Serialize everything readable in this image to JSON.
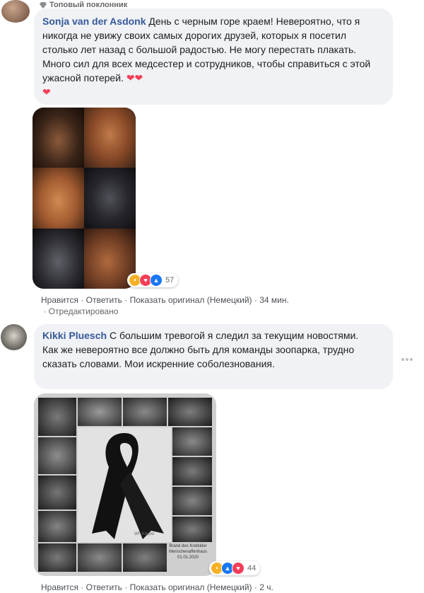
{
  "comment1": {
    "badge": "Топовый поклонник",
    "name": "Sonja van der Asdonk",
    "text": "День с черным горе краем! Невероятно, что я никогда не увижу своих самых дорогих друзей, которых я посетил столько лет назад с большой радостью. Не могу перестать плакать. Много сил для всех медсестер и сотрудников, чтобы справиться с этой ужасной потерей.",
    "reaction_count": "57",
    "actions": {
      "like": "Нравится",
      "reply": "Ответить",
      "show_original": "Показать оригинал (Немецкий)",
      "time": "34 мин.",
      "edited": "Отредактировано"
    }
  },
  "comment2": {
    "name": "Kikki Pluesch",
    "text_line1": "С большим тревогой я следил за текущим новостями.",
    "text_line2": "Как же невероятно все должно быть для команды зоопарка, трудно сказать словами. Мои искренние соболезнования.",
    "reaction_count": "44",
    "image_caption": "Brand des Krefelder Menschenaffenhaus 01.01.2020",
    "watermark": "Wf. Klejow",
    "actions": {
      "like": "Нравится",
      "reply": "Ответить",
      "show_original": "Показать оригинал (Немецкий)",
      "time": "2 ч."
    }
  },
  "colors": {
    "name_link": "#365899",
    "bubble_bg": "#f0f2f5",
    "meta_text": "#65676b",
    "like_blue": "#1877f2",
    "sad_yellow": "#f7b125",
    "love_red": "#f33e58"
  }
}
